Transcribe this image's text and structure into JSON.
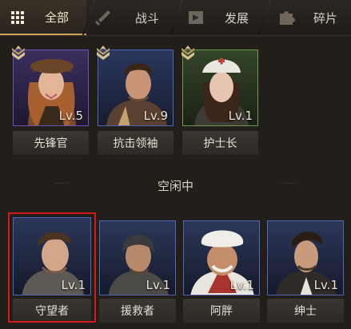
{
  "tabs": [
    {
      "label": "全部",
      "icon": "grid-icon",
      "active": true
    },
    {
      "label": "战斗",
      "icon": "sword-icon",
      "active": false
    },
    {
      "label": "发展",
      "icon": "flag-icon",
      "active": false
    },
    {
      "label": "碎片",
      "icon": "puzzle-icon",
      "active": false
    }
  ],
  "assigned": [
    {
      "name": "先锋官",
      "level": "Lv.5",
      "rank_icon": "rank-chevron-icon",
      "frame": "#6a54b8",
      "bg": "#3b2f5e"
    },
    {
      "name": "抗击领袖",
      "level": "Lv.9",
      "rank_icon": "rank-chevron-icon",
      "frame": "#4e66b8",
      "bg": "#2b375e"
    },
    {
      "name": "护士长",
      "level": "Lv.1",
      "rank_icon": "rank-chevron-icon",
      "frame": "#6f9a47",
      "bg": "#34452a"
    }
  ],
  "idle": {
    "title": "空闲中",
    "heroes": [
      {
        "name": "守望者",
        "level": "Lv.1",
        "frame": "#4e66b8",
        "bg": "#2c3758"
      },
      {
        "name": "援救者",
        "level": "Lv.1",
        "frame": "#4e66b8",
        "bg": "#2c3758"
      },
      {
        "name": "阿胖",
        "level": "Lv.1",
        "frame": "#4e66b8",
        "bg": "#2c3758"
      },
      {
        "name": "绅士",
        "level": "Lv.1",
        "frame": "#4e66b8",
        "bg": "#2c3758"
      }
    ]
  },
  "colors": {
    "accent": "#c9a35a",
    "selected": "#d21c1c"
  }
}
